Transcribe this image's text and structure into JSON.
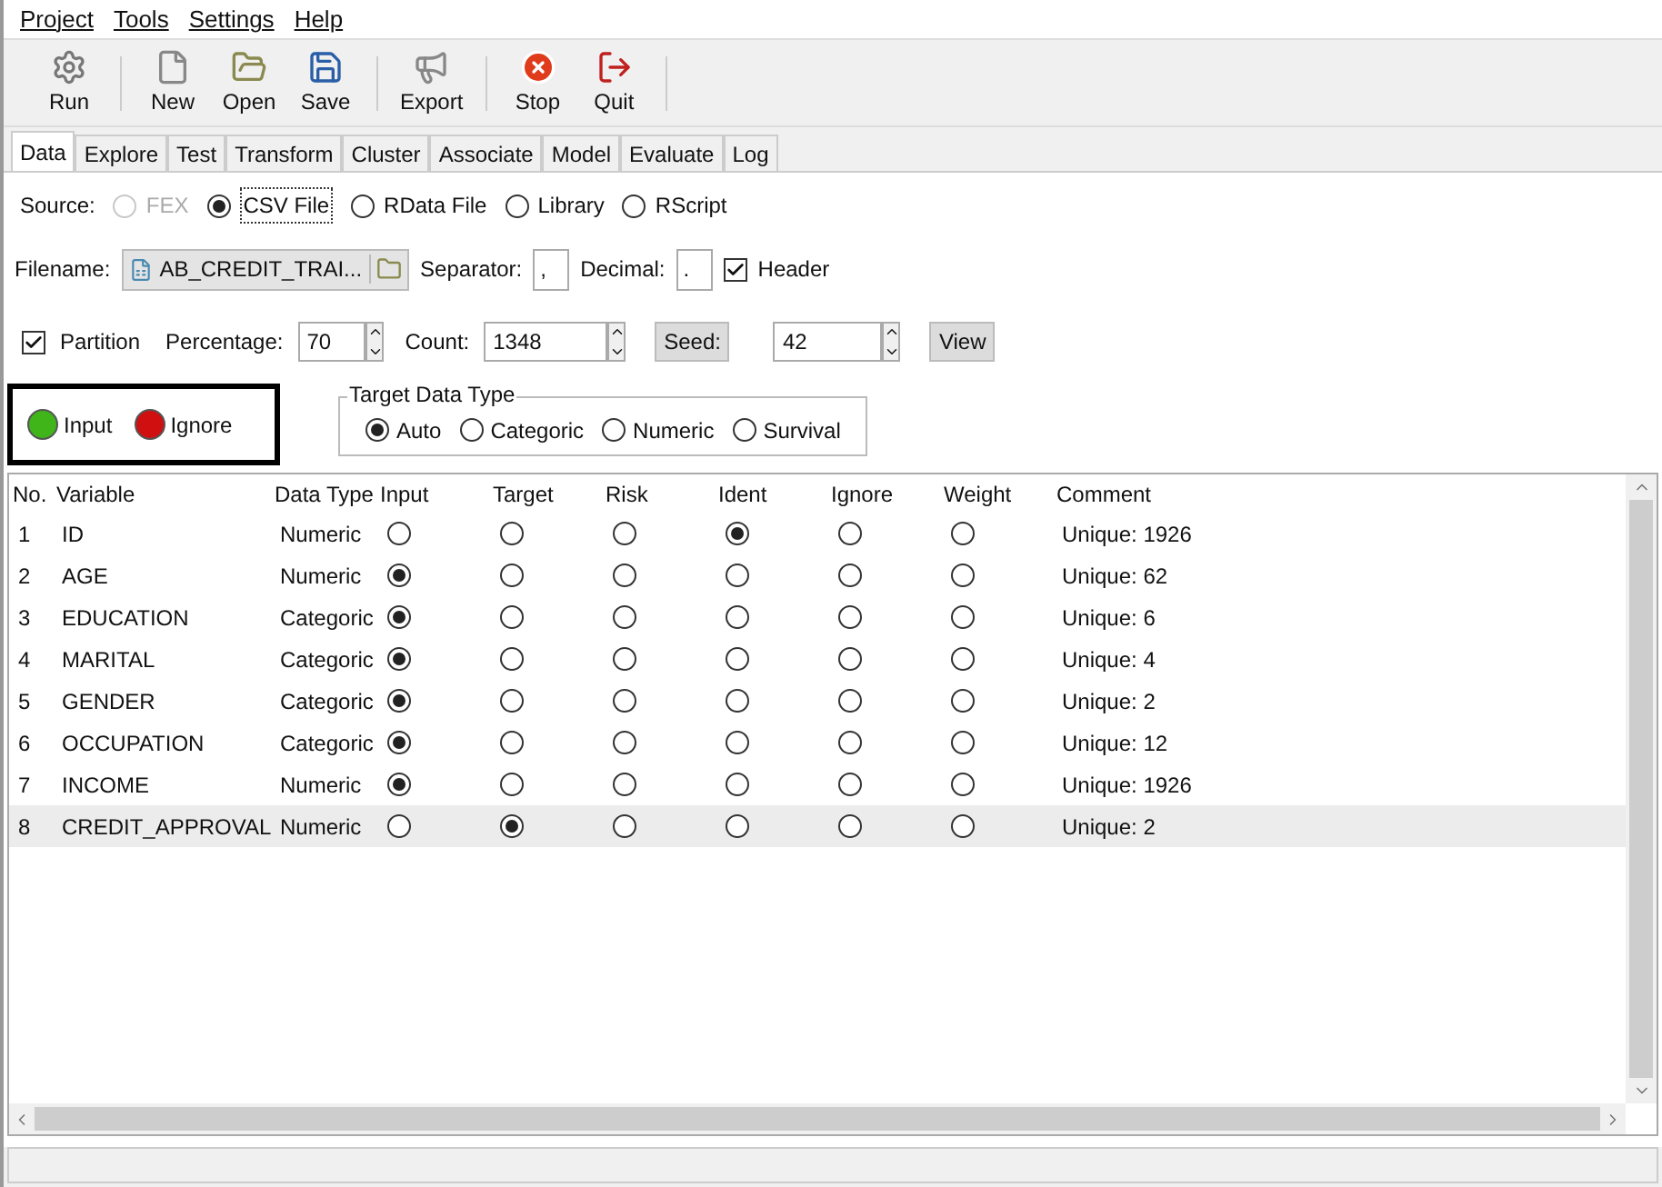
{
  "menu": [
    "Project",
    "Tools",
    "Settings",
    "Help"
  ],
  "toolbar": [
    {
      "kind": "gears",
      "label": "Run"
    },
    {
      "kind": "sep"
    },
    {
      "kind": "new",
      "label": "New"
    },
    {
      "kind": "open",
      "label": "Open"
    },
    {
      "kind": "save",
      "label": "Save"
    },
    {
      "kind": "sep"
    },
    {
      "kind": "export",
      "label": "Export"
    },
    {
      "kind": "sep"
    },
    {
      "kind": "stop",
      "label": "Stop"
    },
    {
      "kind": "quit",
      "label": "Quit"
    },
    {
      "kind": "sep"
    }
  ],
  "tabs": [
    {
      "label": "Data",
      "selected": true
    },
    {
      "label": "Explore",
      "selected": false
    },
    {
      "label": "Test",
      "selected": false
    },
    {
      "label": "Transform",
      "selected": false
    },
    {
      "label": "Cluster",
      "selected": false
    },
    {
      "label": "Associate",
      "selected": false
    },
    {
      "label": "Model",
      "selected": false
    },
    {
      "label": "Evaluate",
      "selected": false
    },
    {
      "label": "Log",
      "selected": false
    }
  ],
  "source": {
    "label": "Source:",
    "options": [
      {
        "label": "FEX",
        "selected": false,
        "disabled": true
      },
      {
        "label": "CSV File",
        "selected": true,
        "disabled": false
      },
      {
        "label": "RData File",
        "selected": false,
        "disabled": false
      },
      {
        "label": "Library",
        "selected": false,
        "disabled": false
      },
      {
        "label": "RScript",
        "selected": false,
        "disabled": false
      }
    ]
  },
  "filename": {
    "label": "Filename:",
    "value": "AB_CREDIT_TRAI...",
    "separator_label": "Separator:",
    "separator": ",",
    "decimal_label": "Decimal:",
    "decimal": ".",
    "header_label": "Header",
    "header_checked": true
  },
  "partition": {
    "label": "Partition",
    "checked": true,
    "percentage_label": "Percentage:",
    "percentage": "70",
    "count_label": "Count:",
    "count": "1348",
    "seed_button": "Seed:",
    "seed": "42",
    "view_button": "View"
  },
  "legend": [
    {
      "label": "Input",
      "color": "#3fb51a"
    },
    {
      "label": "Ignore",
      "color": "#d01010"
    }
  ],
  "target_type": {
    "title": "Target Data Type",
    "options": [
      {
        "label": "Auto",
        "selected": true
      },
      {
        "label": "Categoric",
        "selected": false
      },
      {
        "label": "Numeric",
        "selected": false
      },
      {
        "label": "Survival",
        "selected": false
      }
    ]
  },
  "table": {
    "columns": [
      "No.",
      "Variable",
      "Data Type",
      "Input",
      "Target",
      "Risk",
      "Ident",
      "Ignore",
      "Weight",
      "Comment"
    ],
    "rows": [
      {
        "no": "1",
        "variable": "ID",
        "type": "Numeric",
        "roles": [
          false,
          false,
          false,
          true,
          false,
          false
        ],
        "comment": "Unique: 1926",
        "selected": false
      },
      {
        "no": "2",
        "variable": "AGE",
        "type": "Numeric",
        "roles": [
          true,
          false,
          false,
          false,
          false,
          false
        ],
        "comment": "Unique: 62",
        "selected": false
      },
      {
        "no": "3",
        "variable": "EDUCATION",
        "type": "Categoric",
        "roles": [
          true,
          false,
          false,
          false,
          false,
          false
        ],
        "comment": "Unique: 6",
        "selected": false
      },
      {
        "no": "4",
        "variable": "MARITAL",
        "type": "Categoric",
        "roles": [
          true,
          false,
          false,
          false,
          false,
          false
        ],
        "comment": "Unique: 4",
        "selected": false
      },
      {
        "no": "5",
        "variable": "GENDER",
        "type": "Categoric",
        "roles": [
          true,
          false,
          false,
          false,
          false,
          false
        ],
        "comment": "Unique: 2",
        "selected": false
      },
      {
        "no": "6",
        "variable": "OCCUPATION",
        "type": "Categoric",
        "roles": [
          true,
          false,
          false,
          false,
          false,
          false
        ],
        "comment": "Unique: 12",
        "selected": false
      },
      {
        "no": "7",
        "variable": "INCOME",
        "type": "Numeric",
        "roles": [
          true,
          false,
          false,
          false,
          false,
          false
        ],
        "comment": "Unique: 1926",
        "selected": false
      },
      {
        "no": "8",
        "variable": "CREDIT_APPROVAL",
        "type": "Numeric",
        "roles": [
          false,
          true,
          false,
          false,
          false,
          false
        ],
        "comment": "Unique: 2",
        "selected": true
      }
    ]
  }
}
